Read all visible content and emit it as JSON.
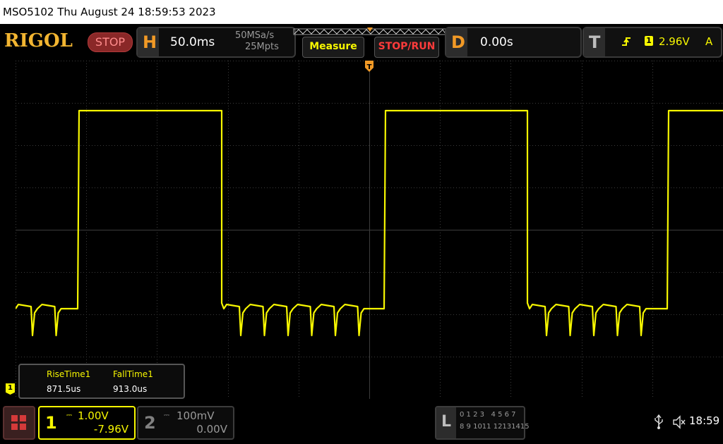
{
  "titlebar": {
    "text": "MSO5102  Thu August 24 18:59:53 2023"
  },
  "brand": {
    "logo": "RIGOL",
    "run_state": "STOP"
  },
  "horizontal": {
    "letter": "H",
    "timebase": "50.0ms",
    "sample_rate": "50MSa/s",
    "memory_depth": "25Mpts"
  },
  "buttons": {
    "measure": "Measure",
    "stop_run": "STOP/RUN"
  },
  "delay": {
    "letter": "D",
    "value": "0.00s"
  },
  "trigger": {
    "letter": "T",
    "source_number": "1",
    "level": "2.96V",
    "mode": "A",
    "marker": "T"
  },
  "measurements": {
    "headers": [
      "RiseTime1",
      "FallTime1"
    ],
    "values": [
      "871.5us",
      "913.0us"
    ]
  },
  "ground_marker": "1",
  "channels": [
    {
      "number": "1",
      "scale": "1.00V",
      "offset": "-7.96V",
      "color": "#f7f700"
    },
    {
      "number": "2",
      "scale": "100mV",
      "offset": "0.00V",
      "color": "#808080"
    }
  ],
  "logic": {
    "letter": "L",
    "row1": "0 1 2 3   4 5 6 7",
    "row2": "8 9 1011 12131415"
  },
  "status": {
    "clock": "18:59"
  },
  "colors": {
    "trace": "#f7f700",
    "accent": "#f29a26",
    "grid": "#3c3c3c"
  }
}
